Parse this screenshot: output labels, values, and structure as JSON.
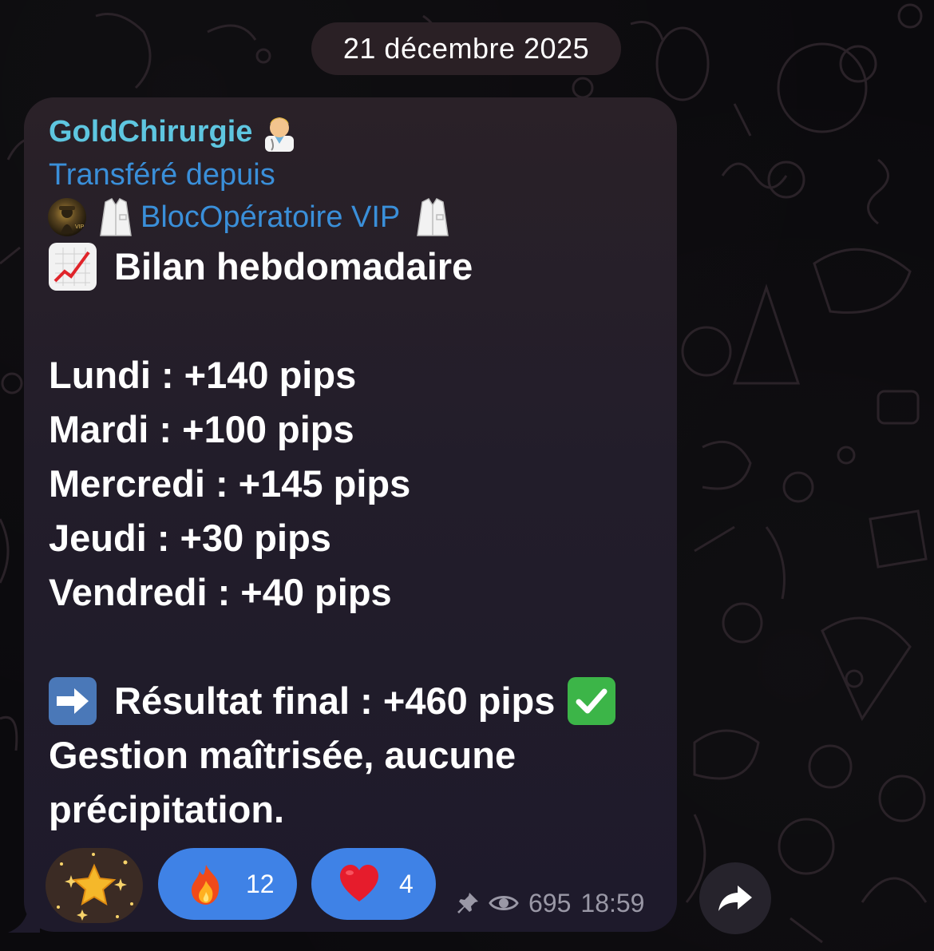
{
  "date_separator": "21 décembre 2025",
  "message": {
    "sender": "GoldChirurgie",
    "sender_emoji": "doctor-emoji",
    "forward_label": "Transféré depuis",
    "forward_source": "BlocOpératoire VIP",
    "title": "Bilan hebdomadaire",
    "days": [
      {
        "text": "Lundi : +140 pips"
      },
      {
        "text": "Mardi : +100 pips"
      },
      {
        "text": "Mercredi : +145 pips"
      },
      {
        "text": "Jeudi : +30 pips"
      },
      {
        "text": "Vendredi : +40 pips"
      }
    ],
    "result": "Résultat final : +460 pips",
    "closing_line1": "Gestion maîtrisée, aucune",
    "closing_line2": "précipitation."
  },
  "reactions": [
    {
      "emoji": "star-emoji",
      "count": ""
    },
    {
      "emoji": "fire-emoji",
      "count": "12"
    },
    {
      "emoji": "heart-emoji",
      "count": "4"
    }
  ],
  "meta": {
    "views": "695",
    "time": "18:59",
    "icons": [
      "pin-icon",
      "eye-icon"
    ]
  },
  "colors": {
    "sender": "#5ec6e0",
    "link": "#3a8fd9",
    "reaction_bg": "#3f82e6",
    "bubble_bg": "#221d2a",
    "meta_text": "#9a98a6"
  }
}
